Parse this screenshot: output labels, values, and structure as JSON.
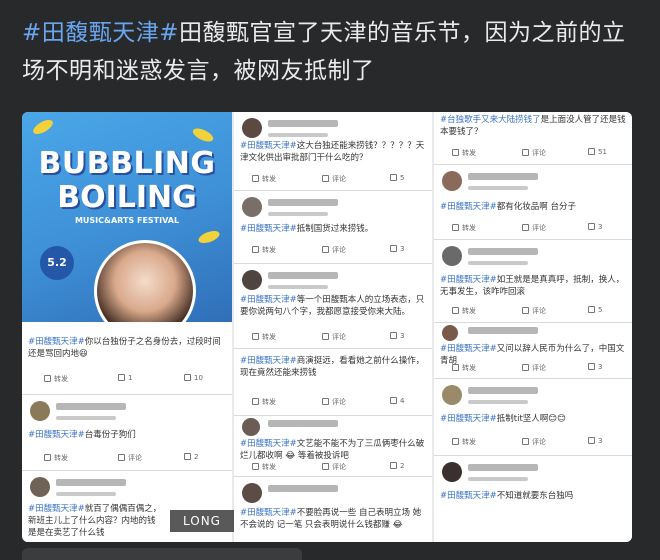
{
  "headline": {
    "tag": "#田馥甄天津#",
    "text": "田馥甄官宣了天津的音乐节，因为之前的立场不明和迷惑发言，被网友抵制了"
  },
  "poster": {
    "title_line1": "BUBBLING",
    "title_line2": "BOILING",
    "subtitle": "MUSIC&ARTS FESTIVAL",
    "date": "5.2"
  },
  "long_label": "LONG",
  "col1": [
    {
      "tag": "#田馥甄天津#",
      "text": "你以台独份子之名身份去，过段时间还是骂回内地😆",
      "forward": "转发",
      "comment": "1",
      "likes": "10"
    },
    {
      "tag": "#田馥甄天津#",
      "text": "台毒份子狗们",
      "forward": "转发",
      "comment": "评论",
      "likes": "2"
    },
    {
      "tag": "#田馥甄天津#",
      "text": "就百了偶偶百偶之，新班主儿上了什么内容？内地的钱是是在卖艺了什么钱"
    }
  ],
  "col2": [
    {
      "tag": "#田馥甄天津#",
      "text": "这大台独还能来捞钱？？？？？天津文化供出审批部门干什么吃的？",
      "forward": "转发",
      "comment": "评论",
      "likes": "5"
    },
    {
      "tag": "#田馥甄天津#",
      "text": "抵制国货过来捞钱。",
      "forward": "转发",
      "comment": "评论",
      "likes": "3"
    },
    {
      "tag": "#田馥甄天津#",
      "text": "等一个田馥甄本人的立场表态，只要你说两句八个字，我都愿意接受你来大陆。",
      "forward": "转发",
      "comment": "评论",
      "likes": "3"
    },
    {
      "tag": "#田馥甄天津#",
      "text": "商演挺远，看看她之前什么操作，现在竟然还能来捞钱",
      "forward": "转发",
      "comment": "评论",
      "likes": "4"
    },
    {
      "tag": "#田馥甄天津#",
      "text": "文艺能不能不为了三瓜俩枣什么破烂儿都收啊 😂 等着被投诉吧",
      "forward": "转发",
      "comment": "评论",
      "likes": "2"
    },
    {
      "tag": "#田馥甄天津#",
      "text": "不要脸再说一些 自己表明立场 她不会说的 记一笔 只会表明说什么钱都赚 😂"
    }
  ],
  "col3": [
    {
      "tag": "#台独歌手又来大陆捞钱了",
      "text": "是上面没人管了还是钱本要钱了？",
      "forward": "转发",
      "comment": "评论",
      "likes": "51"
    },
    {
      "tag": "#田馥甄天津#",
      "text": "都有化妆品啊 台分子",
      "forward": "转发",
      "comment": "评论",
      "likes": "3"
    },
    {
      "tag": "#田馥甄天津#",
      "text": "如王就是是真真呼，抵制，换人，无事发生，该咋咋回滚",
      "forward": "转发",
      "comment": "评论",
      "likes": "5"
    },
    {
      "tag": "#田馥甄天津#",
      "text": "又问以辞人民币为什么了，中国文青胡",
      "forward": "转发",
      "comment": "评论",
      "likes": "3"
    },
    {
      "tag": "#田馥甄天津#",
      "text": "抵制tit坚人啊😊😊",
      "forward": "转发",
      "comment": "评论",
      "likes": "3"
    },
    {
      "tag": "#田馥甄天津#",
      "text": "不知道就要东台独吗"
    }
  ]
}
